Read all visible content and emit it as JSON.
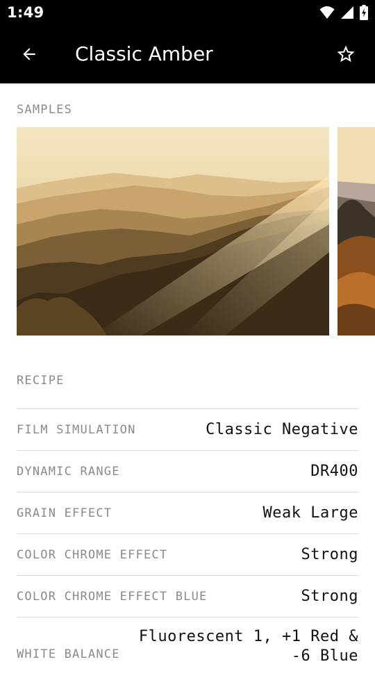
{
  "status_bar": {
    "time": "1:49"
  },
  "app_bar": {
    "title": "Classic Amber"
  },
  "samples": {
    "label": "SAMPLES"
  },
  "recipe": {
    "label": "RECIPE",
    "rows": [
      {
        "key": "FILM SIMULATION",
        "value": "Classic Negative"
      },
      {
        "key": "DYNAMIC RANGE",
        "value": "DR400"
      },
      {
        "key": "GRAIN EFFECT",
        "value": "Weak Large"
      },
      {
        "key": "COLOR CHROME EFFECT",
        "value": "Strong"
      },
      {
        "key": "COLOR CHROME EFFECT BLUE",
        "value": "Strong"
      },
      {
        "key": "WHITE BALANCE",
        "value": "Fluorescent 1, +1 Red & -6 Blue"
      }
    ]
  },
  "colors": {
    "bar_background": "#000000",
    "label_gray": "#8a8a8a",
    "divider": "#dcdcdc"
  },
  "icons": {
    "back": "arrow-back-icon",
    "favorite": "star-outline-icon",
    "wifi": "wifi-icon",
    "signal": "signal-icon",
    "battery": "battery-charging-icon"
  }
}
